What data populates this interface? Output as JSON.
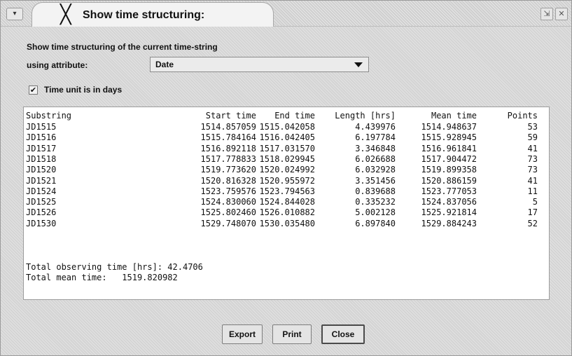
{
  "window": {
    "title": "Show time structuring:",
    "menu_glyph": "▾",
    "controls": [
      "⇲",
      "✕"
    ]
  },
  "form": {
    "heading": "Show time structuring of the current time-string",
    "attribute_label": "using attribute:",
    "attribute_value": "Date",
    "checkbox_label": "Time unit is in days",
    "checkbox_checked": true,
    "checkbox_glyph": "✔"
  },
  "table": {
    "headers": [
      "Substring",
      "Start time",
      "End time",
      "Length [hrs]",
      "Mean time",
      "Points"
    ],
    "rows": [
      [
        "JD1515",
        "1514.857059",
        "1515.042058",
        "4.439976",
        "1514.948637",
        "53"
      ],
      [
        "JD1516",
        "1515.784164",
        "1516.042405",
        "6.197784",
        "1515.928945",
        "59"
      ],
      [
        "JD1517",
        "1516.892118",
        "1517.031570",
        "3.346848",
        "1516.961841",
        "41"
      ],
      [
        "JD1518",
        "1517.778833",
        "1518.029945",
        "6.026688",
        "1517.904472",
        "73"
      ],
      [
        "JD1520",
        "1519.773620",
        "1520.024992",
        "6.032928",
        "1519.899358",
        "73"
      ],
      [
        "JD1521",
        "1520.816328",
        "1520.955972",
        "3.351456",
        "1520.886159",
        "41"
      ],
      [
        "JD1524",
        "1523.759576",
        "1523.794563",
        "0.839688",
        "1523.777053",
        "11"
      ],
      [
        "JD1525",
        "1524.830060",
        "1524.844028",
        "0.335232",
        "1524.837056",
        "5"
      ],
      [
        "JD1526",
        "1525.802460",
        "1526.010882",
        "5.002128",
        "1525.921814",
        "17"
      ],
      [
        "JD1530",
        "1529.748070",
        "1530.035480",
        "6.897840",
        "1529.884243",
        "52"
      ]
    ],
    "total_observing": "Total observing time [hrs]: 42.4706",
    "total_mean": "Total mean time:   1519.820982"
  },
  "buttons": {
    "export": "Export",
    "print": "Print",
    "close": "Close"
  }
}
